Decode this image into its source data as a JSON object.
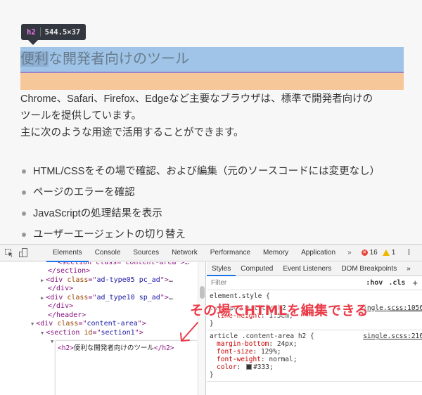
{
  "page": {
    "tooltip": {
      "tag": "h2",
      "dimensions": "544.5×37"
    },
    "heading": {
      "selected": "便利",
      "rest": "な開発者向けのツール"
    },
    "paragraph": {
      "line1": "Chrome、Safari、Firefox、Edgeなど主要なブラウザは、標準で開発者向けの",
      "line2": "ツールを提供しています。",
      "line3": "主に次のような用途で活用することができます。"
    },
    "list": [
      "HTML/CSSをその場で確認、および編集（元のソースコードには変更なし）",
      "ページのエラーを確認",
      "JavaScriptの処理結果を表示",
      "ユーザーエージェントの切り替え"
    ],
    "colors": {
      "content_highlight": "#9fc4e7",
      "margin_highlight": "#f6c899",
      "annotation": "#ea3b48",
      "active_tab": "#1a73e8"
    }
  },
  "devtools": {
    "tabs": [
      "Elements",
      "Console",
      "Sources",
      "Network",
      "Performance",
      "Memory",
      "Application"
    ],
    "active_tab": "Elements",
    "more_tabs": "»",
    "error_count": "16",
    "warning_count": "1",
    "elements": {
      "lines": [
        {
          "indent": 5,
          "tri": "",
          "parts": [
            [
              "tag",
              "<section class=\"content-area\">…"
            ]
          ]
        },
        {
          "indent": 4,
          "tri": "",
          "parts": [
            [
              "tag",
              "</section>"
            ]
          ]
        },
        {
          "indent": 4,
          "tri": "▶",
          "parts": [
            [
              "tag",
              "<div "
            ],
            [
              "attr",
              "class"
            ],
            [
              "tag",
              "=\""
            ],
            [
              "val",
              "ad-type05 pc_ad"
            ],
            [
              "tag",
              "\">"
            ],
            [
              "ell",
              "…"
            ]
          ]
        },
        {
          "indent": 4,
          "tri": "",
          "parts": [
            [
              "tag",
              "</div>"
            ]
          ]
        },
        {
          "indent": 4,
          "tri": "▶",
          "parts": [
            [
              "tag",
              "<div "
            ],
            [
              "attr",
              "class"
            ],
            [
              "tag",
              "=\""
            ],
            [
              "val",
              "ad_type10 sp_ad"
            ],
            [
              "tag",
              "\">"
            ],
            [
              "ell",
              "…"
            ]
          ]
        },
        {
          "indent": 4,
          "tri": "",
          "parts": [
            [
              "tag",
              "</div>"
            ]
          ]
        },
        {
          "indent": 4,
          "tri": "",
          "parts": [
            [
              "tag",
              "</header>"
            ]
          ]
        },
        {
          "indent": 3,
          "tri": "▼",
          "parts": [
            [
              "tag",
              "<div "
            ],
            [
              "attr",
              "class"
            ],
            [
              "tag",
              "=\""
            ],
            [
              "val",
              "content-area"
            ],
            [
              "tag",
              "\">"
            ]
          ]
        },
        {
          "indent": 4,
          "tri": "▼",
          "parts": [
            [
              "tag",
              "<section "
            ],
            [
              "attr",
              "id"
            ],
            [
              "tag",
              "=\""
            ],
            [
              "val",
              "section1"
            ],
            [
              "tag",
              "\">"
            ]
          ]
        },
        {
          "indent": 5,
          "tri": "▼",
          "parts": []
        }
      ],
      "edit_box": {
        "open_tag": "<h2>",
        "text": "便利な開発者向けのツール",
        "close_tag": "</h2>"
      }
    },
    "styles": {
      "subtabs": [
        "Styles",
        "Computed",
        "Event Listeners",
        "DOM Breakpoints",
        "»"
      ],
      "active_subtab": "Styles",
      "filter_placeholder": "Filter",
      "hov": ":hov",
      "cls": ".cls",
      "plus": "+",
      "rules": [
        {
          "selector": "element.style {",
          "source": "",
          "decls": [],
          "close": "}"
        },
        {
          "selector": ".wrapper article h2 {",
          "source": "single.scss:1056",
          "decls": [
            [
              "line-height",
              "1.5em;"
            ]
          ],
          "close": "}"
        },
        {
          "selector": "article .content-area h2 {",
          "source": "single.scss:216",
          "decls": [
            [
              "margin-bottom",
              "24px;"
            ],
            [
              "font-size",
              "129%;"
            ],
            [
              "font-weight",
              "normal;"
            ],
            [
              "color",
              "#333;"
            ]
          ],
          "close": "}"
        }
      ]
    }
  },
  "annotation": {
    "text": "その場でHTMLを編集できる"
  }
}
